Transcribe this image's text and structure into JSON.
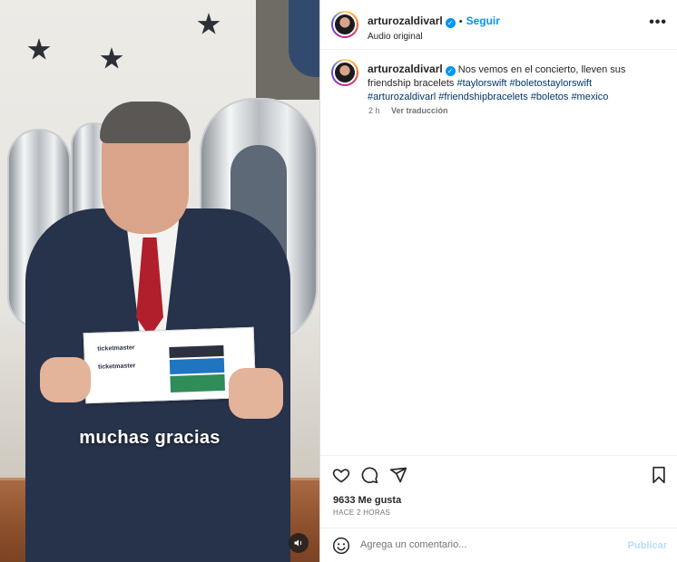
{
  "post": {
    "username": "arturozaldivarl",
    "follow_label": "Seguir",
    "separator": "•",
    "audio": "Audio original",
    "more": "•••"
  },
  "caption": {
    "username": "arturozaldivarl",
    "text": "Nos vemos en el concierto, lleven sus friendship bracelets",
    "hashtags": [
      "#taylorswift",
      "#boletostaylorswift",
      "#arturozaldivarl",
      "#friendshipbracelets",
      "#boletos",
      "#mexico"
    ],
    "age": "2 h",
    "translate": "Ver traducción"
  },
  "video": {
    "subtitle": "muchas gracias",
    "ticket_brand_1": "ticketmaster",
    "ticket_brand_2": "ticketmaster",
    "audio_icon": "speaker-icon"
  },
  "stats": {
    "likes": "9633 Me gusta",
    "time": "HACE 2 HORAS"
  },
  "comment_box": {
    "placeholder": "Agrega un comentario...",
    "publish": "Publicar"
  },
  "colors": {
    "accent": "#0095f6",
    "link": "#00376b",
    "publish_disabled": "#b3dffc"
  }
}
